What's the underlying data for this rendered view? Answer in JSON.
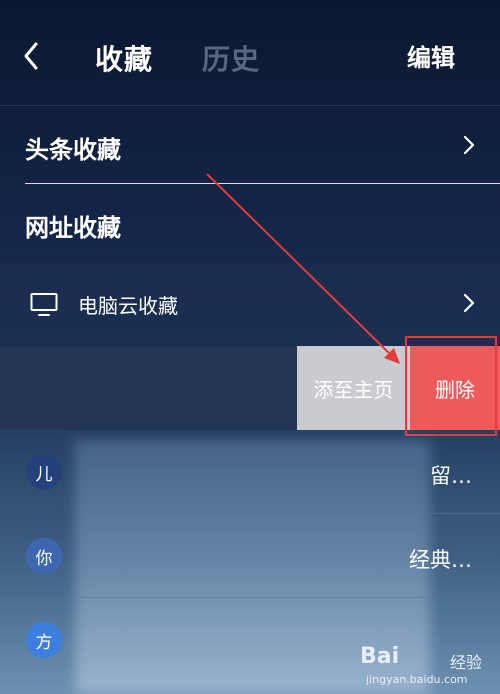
{
  "header": {
    "tabs": [
      {
        "label": "收藏",
        "active": true
      },
      {
        "label": "历史",
        "active": false
      }
    ],
    "edit_label": "编辑"
  },
  "sections": {
    "headline_favorites": "头条收藏",
    "url_favorites": "网址收藏",
    "pc_cloud_favorites": "电脑云收藏"
  },
  "swipe_actions": {
    "add_to_home": "添至主页",
    "delete": "删除"
  },
  "bookmarks": [
    {
      "avatar": "儿",
      "avatar_color": "#23417a",
      "title_tail": "留…"
    },
    {
      "avatar": "你",
      "avatar_color": "#3b68ae",
      "title_tail": "经典…"
    },
    {
      "avatar": "方",
      "avatar_color": "#3d7fe0",
      "title_tail": ""
    }
  ],
  "watermark": {
    "brand": "Bai",
    "brand_tail": "经验",
    "url": "jingyan.baidu.com"
  },
  "colors": {
    "delete": "#f15a5a",
    "add_to_home": "#c9cbcf",
    "annotation": "#e23b3b"
  }
}
